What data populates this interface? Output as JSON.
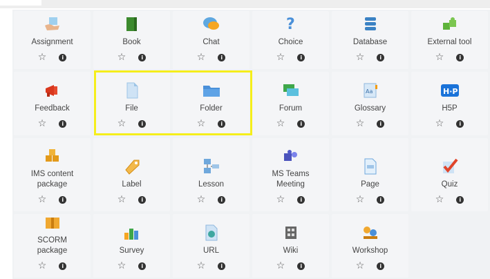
{
  "activities": [
    {
      "label": "Assignment",
      "icon": "assignment-icon"
    },
    {
      "label": "Book",
      "icon": "book-icon"
    },
    {
      "label": "Chat",
      "icon": "chat-icon"
    },
    {
      "label": "Choice",
      "icon": "choice-icon"
    },
    {
      "label": "Database",
      "icon": "database-icon"
    },
    {
      "label": "External tool",
      "icon": "puzzle-icon"
    },
    {
      "label": "Feedback",
      "icon": "megaphone-icon"
    },
    {
      "label": "File",
      "icon": "file-icon"
    },
    {
      "label": "Folder",
      "icon": "folder-icon"
    },
    {
      "label": "Forum",
      "icon": "forum-icon"
    },
    {
      "label": "Glossary",
      "icon": "glossary-icon"
    },
    {
      "label": "H5P",
      "icon": "h5p-icon"
    },
    {
      "label": "IMS content package",
      "icon": "package-icon"
    },
    {
      "label": "Label",
      "icon": "label-icon"
    },
    {
      "label": "Lesson",
      "icon": "lesson-icon"
    },
    {
      "label": "MS Teams Meeting",
      "icon": "teams-icon"
    },
    {
      "label": "Page",
      "icon": "page-icon"
    },
    {
      "label": "Quiz",
      "icon": "quiz-icon"
    },
    {
      "label": "SCORM package",
      "icon": "scorm-icon"
    },
    {
      "label": "Survey",
      "icon": "survey-icon"
    },
    {
      "label": "URL",
      "icon": "url-icon"
    },
    {
      "label": "Wiki",
      "icon": "wiki-icon"
    },
    {
      "label": "Workshop",
      "icon": "workshop-icon"
    }
  ],
  "colors": {
    "highlight": "#f5ee1b",
    "tile": "#f4f5f7"
  }
}
